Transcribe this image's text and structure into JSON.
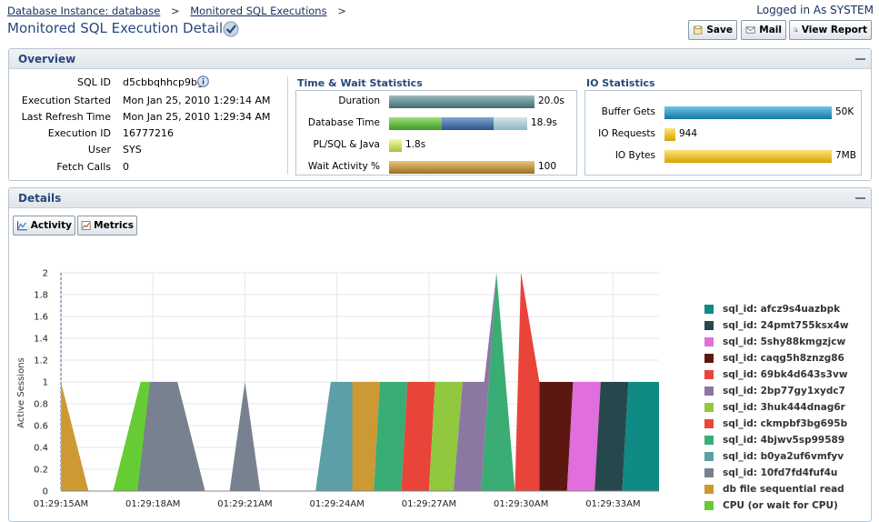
{
  "breadcrumb": {
    "items": [
      "Database Instance: database",
      "Monitored SQL Executions"
    ],
    "separator": ">"
  },
  "header": {
    "login": "Logged in As SYSTEM",
    "title": "Monitored SQL Execution Details"
  },
  "toolbar": {
    "save_label": "Save",
    "mail_label": "Mail",
    "report_label": "View Report"
  },
  "overview": {
    "title": "Overview",
    "fields": [
      {
        "label": "SQL ID",
        "value": "d5cbbqhhcp9bg"
      },
      {
        "label": "Execution Started",
        "value": "Mon Jan 25, 2010 1:29:14 AM"
      },
      {
        "label": "Last Refresh Time",
        "value": "Mon Jan 25, 2010 1:29:34 AM"
      },
      {
        "label": "Execution ID",
        "value": "16777216"
      },
      {
        "label": "User",
        "value": "SYS"
      },
      {
        "label": "Fetch Calls",
        "value": "0"
      }
    ],
    "time_wait": {
      "title": "Time & Wait Statistics",
      "rows": [
        {
          "label": "Duration",
          "value": "20.0s",
          "fraction": 1.0
        },
        {
          "label": "Database Time",
          "value": "18.9s",
          "fraction": 0.945
        },
        {
          "label": "PL/SQL & Java",
          "value": "1.8s",
          "fraction": 0.09
        },
        {
          "label": "Wait Activity %",
          "value": "100",
          "fraction": 1.0
        }
      ]
    },
    "io": {
      "title": "IO Statistics",
      "rows": [
        {
          "label": "Buffer Gets",
          "value": "50K",
          "fraction": 1.0
        },
        {
          "label": "IO Requests",
          "value": "944",
          "fraction": 0.06
        },
        {
          "label": "IO Bytes",
          "value": "7MB",
          "fraction": 1.0
        }
      ]
    }
  },
  "details": {
    "title": "Details",
    "tabs": [
      "Activity",
      "Metrics"
    ]
  },
  "chart_data": {
    "type": "area",
    "title": "",
    "xlabel": "",
    "ylabel": "Active Sessions",
    "ylim": [
      0,
      2
    ],
    "y_ticks": [
      "0",
      "0.2",
      "0.4",
      "0.6",
      "0.8",
      "1",
      "1.2",
      "1.4",
      "1.6",
      "1.8",
      "2"
    ],
    "x_ticks": [
      "01:29:15AM",
      "01:29:18AM",
      "01:29:21AM",
      "01:29:24AM",
      "01:29:27AM",
      "01:29:30AM",
      "01:29:33AM"
    ],
    "x_tick_seconds": [
      15,
      18,
      21,
      24,
      27,
      30,
      33
    ],
    "x_range_seconds": [
      15,
      34.5
    ],
    "grid": true,
    "legend_position": "right",
    "series": [
      {
        "name": "sql_id: afcz9s4uazbpk",
        "color": "#0f8a84",
        "points": [
          [
            33.3,
            0
          ],
          [
            33.5,
            1
          ],
          [
            34.5,
            1
          ],
          [
            34.5,
            0
          ]
        ]
      },
      {
        "name": "sql_id: 24pmt755ksx4w",
        "color": "#26484c",
        "points": [
          [
            32.4,
            0
          ],
          [
            32.6,
            1
          ],
          [
            33.5,
            1
          ],
          [
            33.3,
            0
          ]
        ]
      },
      {
        "name": "sql_id: 5shy88kmgzjcw",
        "color": "#e06edc",
        "points": [
          [
            31.5,
            0
          ],
          [
            31.7,
            1
          ],
          [
            32.6,
            1
          ],
          [
            32.4,
            0
          ]
        ]
      },
      {
        "name": "sql_id: caqg5h8znzg86",
        "color": "#5c1810",
        "points": [
          [
            30.6,
            0
          ],
          [
            30.6,
            1
          ],
          [
            31.7,
            1
          ],
          [
            31.5,
            0
          ]
        ]
      },
      {
        "name": "sql_id: 69bk4d643s3vw",
        "color": "#e8443a",
        "points": [
          [
            30.0,
            2
          ],
          [
            30.6,
            1
          ],
          [
            30.6,
            0
          ],
          [
            29.8,
            0
          ]
        ]
      },
      {
        "name": "sql_id: 2bp77gy1xydc7",
        "color": "#8c77a3",
        "points": [
          [
            27.8,
            0
          ],
          [
            28.1,
            1
          ],
          [
            28.8,
            1
          ],
          [
            29.2,
            2
          ],
          [
            28.7,
            0
          ]
        ]
      },
      {
        "name": "sql_id: 3huk444dnag6r",
        "color": "#92c83e",
        "points": [
          [
            27.0,
            0
          ],
          [
            27.2,
            1
          ],
          [
            28.1,
            1
          ],
          [
            27.8,
            0
          ]
        ]
      },
      {
        "name": "sql_id: ckmpbf3bg695b",
        "color": "#e8443a",
        "points": [
          [
            26.1,
            0
          ],
          [
            26.3,
            1
          ],
          [
            27.2,
            1
          ],
          [
            27.0,
            0
          ]
        ]
      },
      {
        "name": "sql_id: 4bjwv5sp99589",
        "color": "#3aad74",
        "points": [
          [
            25.2,
            0
          ],
          [
            25.4,
            1
          ],
          [
            26.3,
            1
          ],
          [
            26.1,
            0
          ],
          [
            28.7,
            0
          ],
          [
            29.2,
            2
          ],
          [
            29.8,
            0
          ]
        ]
      },
      {
        "name": "sql_id: b0ya2uf6vmfyv",
        "color": "#5c9fa6",
        "points": [
          [
            23.3,
            0
          ],
          [
            23.8,
            1
          ],
          [
            24.5,
            1
          ],
          [
            24.5,
            0
          ]
        ]
      },
      {
        "name": "sql_id: 10fd7fd4fuf4u",
        "color": "#77818f",
        "points": [
          [
            17.5,
            0
          ],
          [
            17.9,
            1
          ],
          [
            18.8,
            1
          ],
          [
            19.7,
            0
          ],
          [
            20.5,
            0
          ],
          [
            21.0,
            1
          ],
          [
            21.5,
            0
          ]
        ]
      },
      {
        "name": "db file sequential read",
        "color": "#cc9933",
        "points": [
          [
            15.0,
            0
          ],
          [
            15.0,
            1
          ],
          [
            15.9,
            0
          ],
          [
            24.1,
            0
          ],
          [
            24.5,
            1
          ],
          [
            25.4,
            1
          ],
          [
            25.2,
            0
          ]
        ]
      },
      {
        "name": "CPU (or wait for CPU)",
        "color": "#66cc33",
        "points": [
          [
            16.7,
            0
          ],
          [
            17.6,
            1
          ],
          [
            17.9,
            1
          ],
          [
            18.8,
            0
          ]
        ]
      }
    ]
  }
}
